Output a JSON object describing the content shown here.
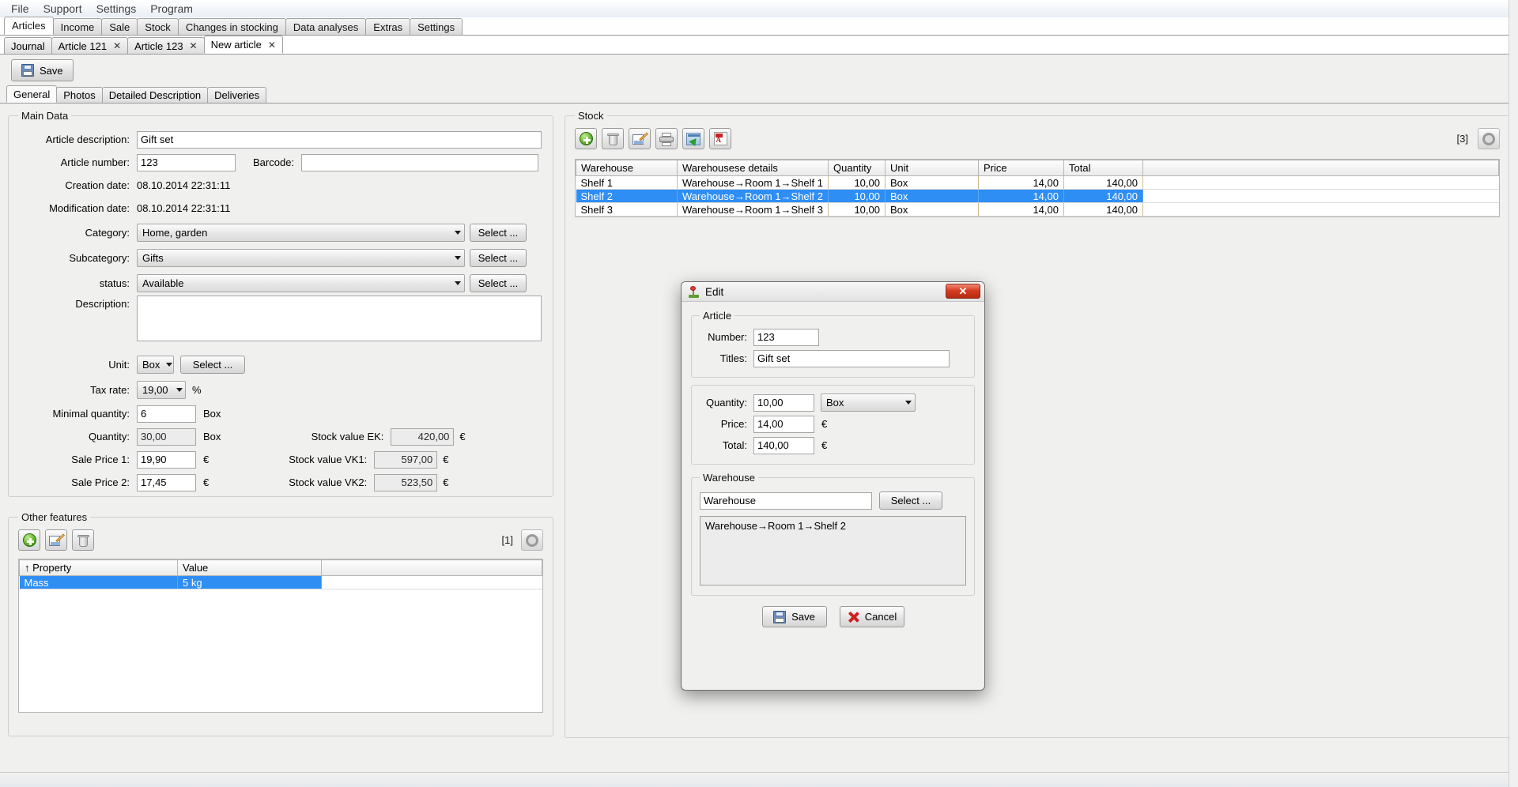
{
  "menu": {
    "items": [
      "File",
      "Support",
      "Settings",
      "Program"
    ]
  },
  "main_tabs": [
    {
      "label": "Articles",
      "active": true
    },
    {
      "label": "Income",
      "active": false
    },
    {
      "label": "Sale",
      "active": false
    },
    {
      "label": "Stock",
      "active": false
    },
    {
      "label": "Changes in stocking",
      "active": false
    },
    {
      "label": "Data analyses",
      "active": false
    },
    {
      "label": "Extras",
      "active": false
    },
    {
      "label": "Settings",
      "active": false
    }
  ],
  "sub_tabs": [
    {
      "label": "Journal",
      "closable": false,
      "active": false
    },
    {
      "label": "Article 121",
      "closable": true,
      "active": false
    },
    {
      "label": "Article 123",
      "closable": true,
      "active": false
    },
    {
      "label": "New article",
      "closable": true,
      "active": true
    }
  ],
  "toolbar": {
    "save_label": "Save"
  },
  "inner_tabs": [
    {
      "label": "General",
      "active": true
    },
    {
      "label": "Photos",
      "active": false
    },
    {
      "label": "Detailed Description",
      "active": false
    },
    {
      "label": "Deliveries",
      "active": false
    }
  ],
  "main_data": {
    "legend": "Main Data",
    "article_description_label": "Article description:",
    "article_description_value": "Gift set",
    "article_number_label": "Article number:",
    "article_number_value": "123",
    "barcode_label": "Barcode:",
    "barcode_value": "",
    "creation_date_label": "Creation date:",
    "creation_date_value": "08.10.2014  22:31:11",
    "modification_date_label": "Modification date:",
    "modification_date_value": "08.10.2014  22:31:11",
    "category_label": "Category:",
    "category_value": "Home, garden",
    "category_select": "Select ...",
    "subcategory_label": "Subcategory:",
    "subcategory_value": "Gifts",
    "subcategory_select": "Select ...",
    "status_label": "status:",
    "status_value": "Available",
    "status_select": "Select ...",
    "description_label": "Description:",
    "description_value": "",
    "unit_label": "Unit:",
    "unit_value": "Box",
    "unit_select": "Select ...",
    "tax_rate_label": "Tax rate:",
    "tax_rate_value": "19,00",
    "tax_rate_suffix": "%",
    "minimal_quantity_label": "Minimal quantity:",
    "minimal_quantity_value": "6",
    "minimal_quantity_unit": "Box",
    "quantity_label": "Quantity:",
    "quantity_value": "30,00",
    "quantity_unit": "Box",
    "sale_price_1_label": "Sale Price 1:",
    "sale_price_1_value": "19,90",
    "sale_price_2_label": "Sale Price 2:",
    "sale_price_2_value": "17,45",
    "currency": "€",
    "stock_value_ek_label": "Stock value EK:",
    "stock_value_ek_value": "420,00",
    "stock_value_vk1_label": "Stock value VK1:",
    "stock_value_vk1_value": "597,00",
    "stock_value_vk2_label": "Stock value VK2:",
    "stock_value_vk2_value": "523,50"
  },
  "other_features": {
    "legend": "Other features",
    "count": "[1]",
    "columns": [
      "↑ Property",
      "Value"
    ],
    "rows": [
      {
        "property": "Mass",
        "value": "5 kg",
        "selected": true
      }
    ],
    "buttons": [
      "add-icon",
      "edit-icon",
      "delete-icon"
    ],
    "settings_icon": "gear-icon"
  },
  "stock": {
    "legend": "Stock",
    "count": "[3]",
    "toolbar_icons": [
      "add-icon",
      "delete-icon",
      "edit-icon",
      "print-icon",
      "export-icon",
      "pdf-icon"
    ],
    "settings_icon": "gear-icon",
    "columns": [
      "Warehouse",
      "Warehousese details",
      "Quantity",
      "Unit",
      "Price",
      "Total"
    ],
    "rows": [
      {
        "warehouse": "Shelf 1",
        "details": "Warehouse→Room 1→Shelf 1",
        "quantity": "10,00",
        "unit": "Box",
        "price": "14,00",
        "total": "140,00",
        "selected": false
      },
      {
        "warehouse": "Shelf 2",
        "details": "Warehouse→Room 1→Shelf 2",
        "quantity": "10,00",
        "unit": "Box",
        "price": "14,00",
        "total": "140,00",
        "selected": true
      },
      {
        "warehouse": "Shelf 3",
        "details": "Warehouse→Room 1→Shelf 3",
        "quantity": "10,00",
        "unit": "Box",
        "price": "14,00",
        "total": "140,00",
        "selected": false
      }
    ]
  },
  "dialog": {
    "title": "Edit",
    "close_label": "✕",
    "article_legend": "Article",
    "number_label": "Number:",
    "number_value": "123",
    "titles_label": "Titles:",
    "titles_value": "Gift set",
    "quantity_label": "Quantity:",
    "quantity_value": "10,00",
    "quantity_unit": "Box",
    "price_label": "Price:",
    "price_value": "14,00",
    "total_label": "Total:",
    "total_value": "140,00",
    "currency": "€",
    "warehouse_legend": "Warehouse",
    "warehouse_value": "Warehouse",
    "warehouse_select": "Select ...",
    "warehouse_path": "Warehouse→Room 1→Shelf 2",
    "save_label": "Save",
    "cancel_label": "Cancel"
  },
  "colors": {
    "selection": "#2f8ef4",
    "close_button": "#d63d22",
    "accent_green": "#4fa51c"
  }
}
